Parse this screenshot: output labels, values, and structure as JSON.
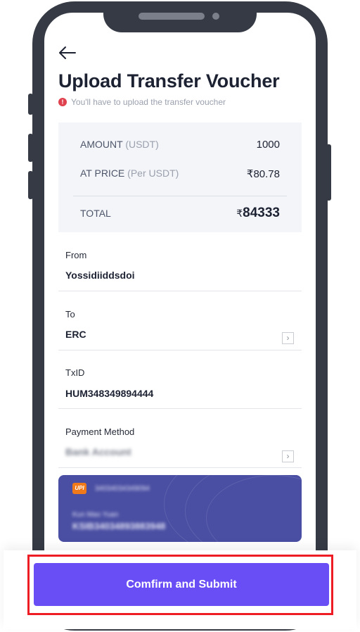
{
  "header": {
    "title": "Upload Transfer Voucher",
    "subtitle": "You'll have to upload the transfer voucher",
    "warning_glyph": "!"
  },
  "summary": {
    "amount_label": "AMOUNT",
    "amount_unit": "(USDT)",
    "amount_value": "1000",
    "price_label": "AT PRICE",
    "price_unit": "(Per USDT)",
    "price_value": "₹80.78",
    "total_label": "TOTAL",
    "total_currency": "₹",
    "total_value": "84333"
  },
  "fields": {
    "from_label": "From",
    "from_value": "Yossidiiddsdoi",
    "to_label": "To",
    "to_value": "ERC",
    "txid_label": "TxID",
    "txid_value": "HUM348349894444",
    "payment_label": "Payment Method",
    "payment_value": "Bank Account"
  },
  "card": {
    "logo_text": "UPI",
    "top_number": "34034034349094",
    "holder_name": "Kun Mao Yuan",
    "account_number": "KSIB34034893883948"
  },
  "actions": {
    "submit_label": "Comfirm and Submit"
  },
  "colors": {
    "accent": "#6a4ef5",
    "highlight": "#ee1c24",
    "card": "#4b4fa3",
    "frame": "#353a44"
  },
  "icons": {
    "back": "back-arrow-icon",
    "chevron": "chevron-right-icon",
    "warning": "warning-icon"
  }
}
